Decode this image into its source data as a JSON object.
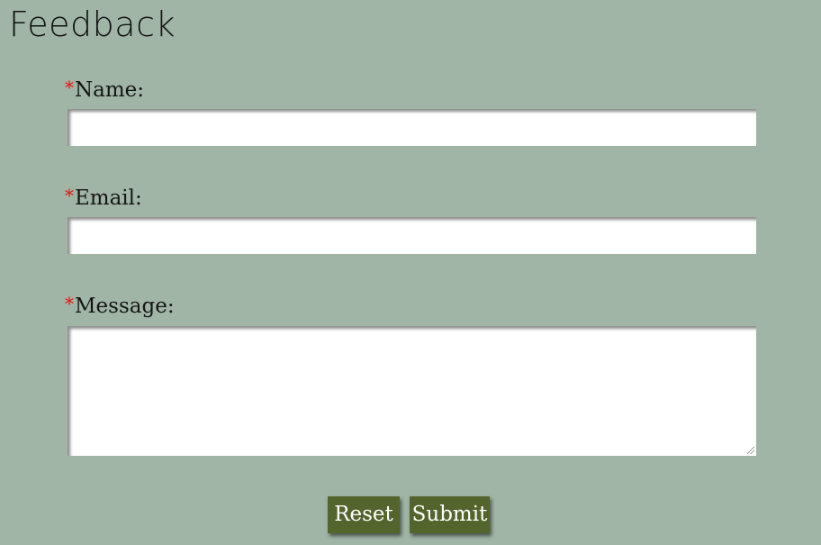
{
  "page": {
    "title": "Feedback"
  },
  "form": {
    "required_marker": "*",
    "fields": [
      {
        "label": "Name:",
        "value": "",
        "type": "text"
      },
      {
        "label": "Email:",
        "value": "",
        "type": "email"
      },
      {
        "label": "Message:",
        "value": "",
        "type": "textarea"
      }
    ],
    "buttons": {
      "reset_label": "Reset",
      "submit_label": "Submit"
    }
  },
  "colors": {
    "background": "#a0b5a6",
    "button": "#53652d",
    "required_marker": "#e8120f",
    "input_background": "#ffffff"
  }
}
